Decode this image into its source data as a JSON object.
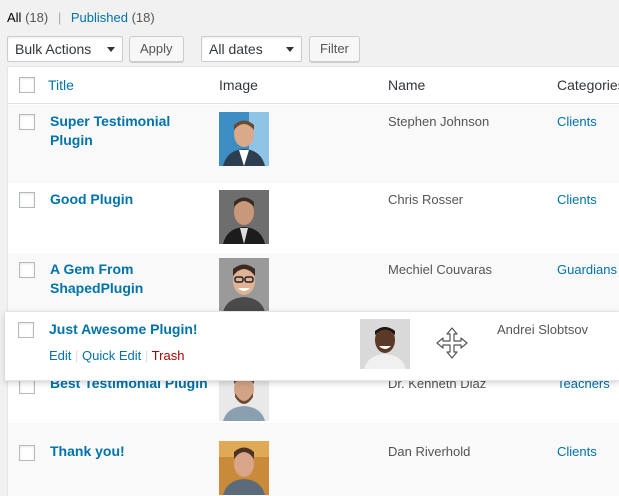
{
  "filters": {
    "all_label": "All",
    "all_count": "(18)",
    "published_label": "Published",
    "published_count": "(18)"
  },
  "toolbar": {
    "bulk_actions": "Bulk Actions",
    "apply": "Apply",
    "dates": "All dates",
    "filter": "Filter"
  },
  "columns": {
    "title": "Title",
    "image": "Image",
    "name": "Name",
    "categories": "Categories"
  },
  "rows": [
    {
      "title": "Super Testimonial Plugin",
      "name": "Stephen Johnson",
      "category": "Clients"
    },
    {
      "title": "Good Plugin",
      "name": "Chris Rosser",
      "category": "Clients"
    },
    {
      "title": "A Gem From ShapedPlugin",
      "name": "Mechiel Couvaras",
      "category": "Guardians"
    },
    {
      "title": "Best Testimonial Plugin",
      "name": "Dr. Kenneth Diaz",
      "category": "Teachers"
    },
    {
      "title": "Thank you!",
      "name": "Dan Riverhold",
      "category": "Clients"
    }
  ],
  "dragging": {
    "title": "Just Awesome Plugin!",
    "name": "Andrei Slobtsov",
    "actions": {
      "edit": "Edit",
      "quick_edit": "Quick Edit",
      "trash": "Trash"
    },
    "icon": "move-icon"
  },
  "colors": {
    "link": "#0073aa",
    "trash": "#a00000"
  }
}
